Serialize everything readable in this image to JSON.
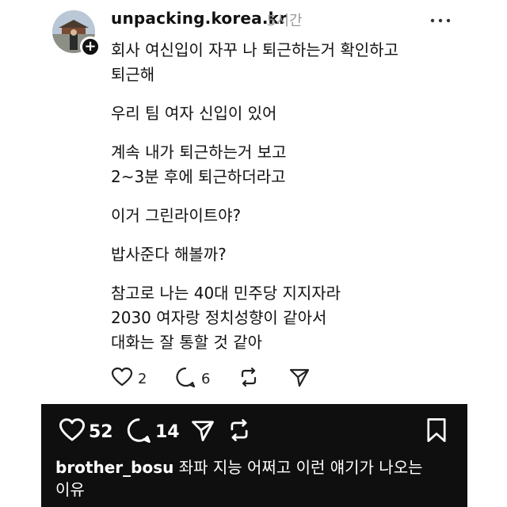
{
  "post": {
    "username": "unpacking.korea.kr",
    "time": "5시간",
    "paragraphs": [
      "회사 여신입이 자꾸 나 퇴근하는거 확인하고\n퇴근해",
      "우리 팀 여자 신입이 있어",
      "계속 내가 퇴근하는거 보고\n2~3분 후에 퇴근하더라고",
      "이거 그린라이트야?",
      "밥사준다 해볼까?",
      "참고로 나는 40대 민주당 지지자라\n2030 여자랑 정치성향이 같아서\n대화는 잘 통할 것 같아"
    ],
    "like_count": "2",
    "comment_count": "6",
    "icons": [
      "heart-icon",
      "comment-icon",
      "repost-icon",
      "share-icon",
      "more-icon",
      "follow-plus-icon"
    ]
  },
  "instagram_bar": {
    "like_count": "52",
    "comment_count": "14",
    "caption_user": "brother_bosu",
    "caption_text": "좌파 지능 어쩌고 이런 얘기가 나오는\n이유",
    "background": "#0f0f0f",
    "icons": [
      "heart-icon",
      "comment-icon",
      "share-icon",
      "repost-icon",
      "bookmark-icon"
    ]
  }
}
